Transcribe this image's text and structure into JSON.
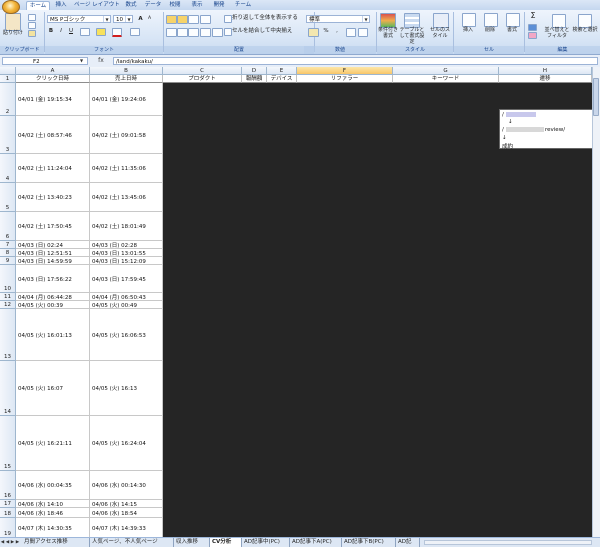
{
  "ribbon": {
    "tabs": [
      "ホーム",
      "挿入",
      "ページ レイアウト",
      "数式",
      "データ",
      "校閲",
      "表示",
      "開発",
      "チーム"
    ],
    "clipboard": {
      "paste_label": "貼り付け",
      "group_label": "クリップボード"
    },
    "font": {
      "name": "MS Pゴシック",
      "size": "10",
      "group_label": "フォント",
      "bold": "B",
      "italic": "I",
      "underline": "U",
      "grow": "A",
      "shrink": "A"
    },
    "alignment": {
      "wrap_label": "折り返して全体を表示する",
      "merge_label": "セルを結合して中央揃え",
      "group_label": "配置"
    },
    "number": {
      "format": "標準",
      "percent": "%",
      "comma": ",",
      "group_label": "数値"
    },
    "styles": {
      "conditional": "条件付き書式",
      "table": "テーブルとして書式設定",
      "cell": "セルのスタイル",
      "group_label": "スタイル"
    },
    "cells": {
      "insert": "挿入",
      "delete": "削除",
      "format": "書式",
      "group_label": "セル"
    },
    "editing": {
      "sigma": "Σ",
      "sort": "並べ替えとフィルタ",
      "find": "検索と選択",
      "group_label": "編集"
    }
  },
  "formula_bar": {
    "name_box": "F2",
    "fx": "fx",
    "value": "/land/kakaku/"
  },
  "grid": {
    "columns": [
      "A",
      "B",
      "C",
      "D",
      "E",
      "F",
      "G",
      "H"
    ],
    "selected_column": "F",
    "headers": [
      "クリック日時",
      "売上日時",
      "プロダクト",
      "報酬額",
      "デバイス",
      "リファラー",
      "キーワード",
      "遷移"
    ],
    "rows": [
      {
        "n": "2",
        "a": "04/01 (金) 19:15:34",
        "b": "04/01 (金) 19:24:06"
      },
      {
        "n": "3",
        "a": "04/02 (土) 08:57:46",
        "b": "04/02 (土) 09:01:58"
      },
      {
        "n": "4",
        "a": "04/02 (土) 11:24:04",
        "b": "04/02 (土) 11:35:06"
      },
      {
        "n": "5",
        "a": "04/02 (土) 13:40:23",
        "b": "04/02 (土) 13:45:06"
      },
      {
        "n": "6",
        "a": "04/02 (土) 17:50:45",
        "b": "04/02 (土) 18:01:49"
      },
      {
        "n": "7",
        "a": "04/03 (日) 02:24",
        "b": "04/03 (日) 02:28"
      },
      {
        "n": "8",
        "a": "04/03 (日) 12:51:51",
        "b": "04/03 (日) 13:01:55"
      },
      {
        "n": "9",
        "a": "04/03 (日) 14:59:59",
        "b": "04/03 (日) 15:12:09"
      },
      {
        "n": "10",
        "a": "04/03 (日) 17:56:22",
        "b": "04/03 (日) 17:59:45"
      },
      {
        "n": "11",
        "a": "04/04 (月) 06:44:28",
        "b": "04/04 (月) 06:50:43"
      },
      {
        "n": "12",
        "a": "04/05 (火) 00:39",
        "b": "04/05 (火) 00:49"
      },
      {
        "n": "13",
        "a": "04/05 (火) 16:01:13",
        "b": "04/05 (火) 16:06:53"
      },
      {
        "n": "14",
        "a": "04/05 (火) 16:07",
        "b": "04/05 (火) 16:13"
      },
      {
        "n": "15",
        "a": "04/05 (火) 16:21:11",
        "b": "04/05 (火) 16:24:04"
      },
      {
        "n": "16",
        "a": "04/06 (水) 00:04:35",
        "b": "04/06 (水) 00:14:30"
      },
      {
        "n": "17",
        "a": "04/06 (水) 14:10",
        "b": "04/06 (水) 14:15"
      },
      {
        "n": "18",
        "a": "04/06 (水) 18:46",
        "b": "04/06 (水) 18:54"
      },
      {
        "n": "19",
        "a": "04/07 (木) 14:30:35",
        "b": "04/07 (木) 14:39:33"
      }
    ],
    "popup": {
      "line1": "/",
      "arrow1": "↓",
      "line2": "/",
      "line2_suffix": "review/",
      "arrow2": "↓",
      "line3": "成約"
    }
  },
  "sheet_tabs": [
    "月間アクセス推移",
    "人気ページ、不人気ページ",
    "収入推移",
    "CV分析",
    "AD記事中(PC)",
    "AD記事下A(PC)",
    "AD記事下B(PC)",
    "AD記"
  ],
  "active_sheet_index": 3,
  "colors": {
    "dark_fill": "#252525",
    "ribbon": "#d6e4f5",
    "selected_header": "#f8c66a"
  }
}
